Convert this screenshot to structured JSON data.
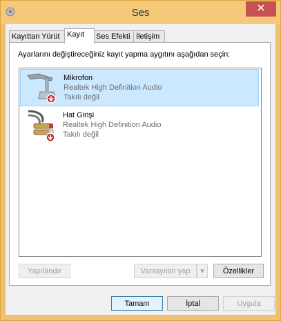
{
  "window": {
    "title": "Ses",
    "close_glyph": "✕"
  },
  "tabs": [
    {
      "label": "Kayıttan Yürüt"
    },
    {
      "label": "Kayıt"
    },
    {
      "label": "Ses Efekti"
    },
    {
      "label": "İletişim"
    }
  ],
  "panel": {
    "instruction": "Ayarlarını değiştireceğiniz kayıt yapma aygıtını aşağıdan seçin:"
  },
  "devices": [
    {
      "name": "Mikrofon",
      "driver": "Realtek High Definition Audio",
      "status": "Takılı değil",
      "icon": "microphone-icon"
    },
    {
      "name": "Hat Girişi",
      "driver": "Realtek High Definition Audio",
      "status": "Takılı değil",
      "icon": "line-in-jack-icon"
    }
  ],
  "buttons": {
    "configure": "Yapılandır",
    "set_default": "Varsayılan yap",
    "dropdown_arrow": "▾",
    "properties": "Özellikler",
    "ok": "Tamam",
    "cancel": "İptal",
    "apply": "Uygula"
  },
  "colors": {
    "titlebar": "#f6c97a",
    "close": "#c75050",
    "selection": "#cce8ff",
    "status_badge": "#c62828"
  }
}
